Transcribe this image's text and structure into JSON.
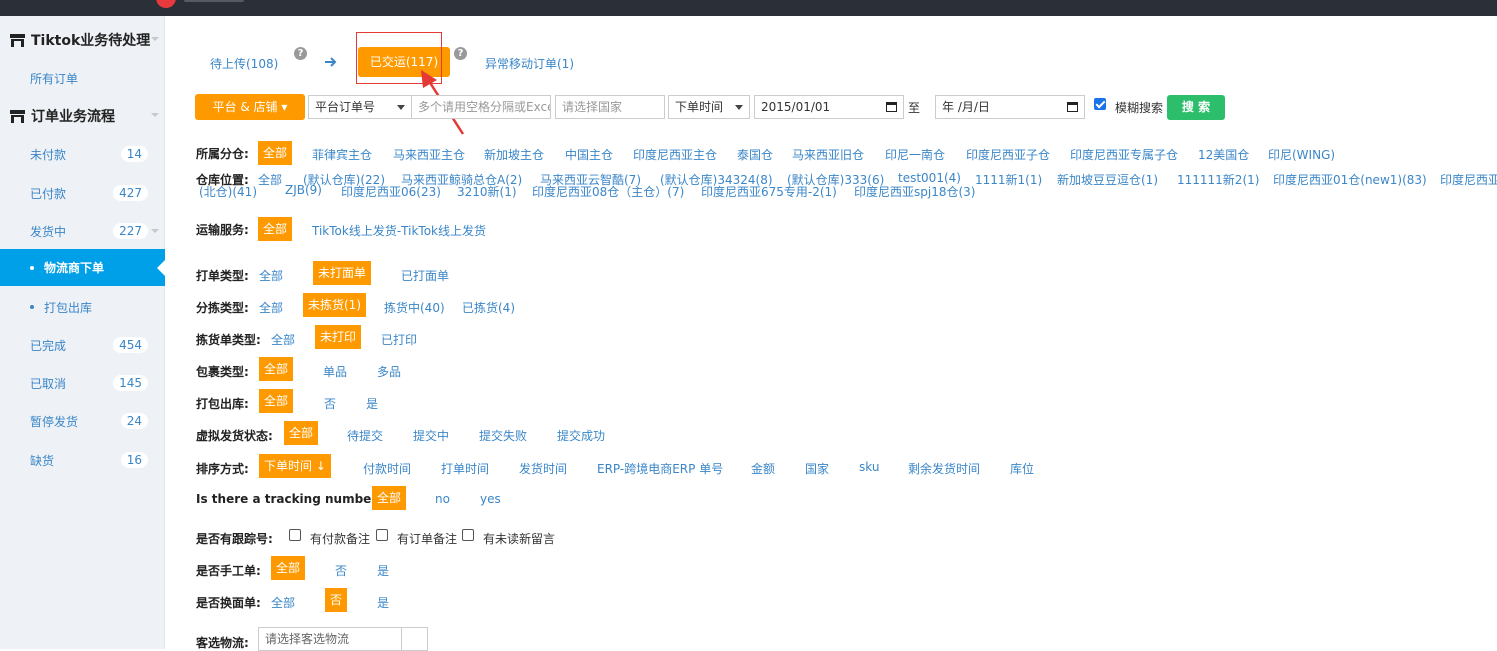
{
  "sidebar": {
    "groups": [
      {
        "label": "Tiktok业务待处理"
      },
      {
        "label": "订单业务流程"
      }
    ],
    "items": [
      {
        "label": "所有订单"
      },
      {
        "label": "未付款",
        "count": "14"
      },
      {
        "label": "已付款",
        "count": "427"
      },
      {
        "label": "发货中",
        "count": "227"
      },
      {
        "label": "物流商下单"
      },
      {
        "label": "打包出库"
      },
      {
        "label": "已完成",
        "count": "454"
      },
      {
        "label": "已取消",
        "count": "145"
      },
      {
        "label": "暂停发货",
        "count": "24"
      },
      {
        "label": "缺货",
        "count": "16"
      }
    ]
  },
  "tabs": {
    "pending_upload": "待上传(108)",
    "shipped": "已交运(117)",
    "abnormal_moved": "异常移动订单(1)"
  },
  "search": {
    "platform_store_btn": "平台 & 店铺",
    "order_no_type": "平台订单号",
    "order_no_placeholder": "多个请用空格分隔或Excel",
    "country_placeholder": "请选择国家",
    "time_type": "下单时间",
    "date_from": "2015/01/01",
    "date_to_label": "至",
    "date_to_placeholder": "年 /月/日",
    "fuzzy_label": "模糊搜索",
    "search_btn": "搜 索"
  },
  "filters": {
    "branch": {
      "label": "所属分仓:",
      "options": [
        "全部",
        "菲律宾主仓",
        "马来西亚主仓",
        "新加坡主仓",
        "中国主仓",
        "印度尼西亚主仓",
        "泰国仓",
        "马来西亚旧仓",
        "印尼一南仓",
        "印度尼西亚子仓",
        "印度尼西亚专属子仓",
        "12美国仓",
        "印尼(WING)"
      ]
    },
    "warehouse": {
      "label": "仓库位置:",
      "line1": [
        "全部",
        "(默认仓库)(22)",
        "马来西亚鲸骑总仓A(2)",
        "马来西亚云智酷(7)",
        "(默认仓库)34324(8)",
        "(默认仓库)333(6)",
        "test001(4)",
        "1111新1(1)",
        "新加坡豆豆逗仓(1)",
        "111111新2(1)",
        "印度尼西亚01仓(new1)(83)",
        "印度尼西亚"
      ],
      "line2": [
        "(北仓)(41)",
        "ZJB(9)",
        "印度尼西亚06(23)",
        "3210新(1)",
        "印度尼西亚08仓（主仓）(7)",
        "印度尼西亚675专用-2(1)",
        "印度尼西亚spj18仓(3)"
      ]
    },
    "shipping": {
      "label": "运输服务:",
      "options": [
        "全部",
        "TikTok线上发货-TikTok线上发货"
      ]
    },
    "print_type": {
      "label": "打单类型:",
      "options": [
        "全部",
        "未打面单",
        "已打面单"
      ]
    },
    "pick_type": {
      "label": "分拣类型:",
      "options": [
        "全部",
        "未拣货(1)",
        "拣货中(40)",
        "已拣货(4)"
      ]
    },
    "pick_list_type": {
      "label": "拣货单类型:",
      "options": [
        "全部",
        "未打印",
        "已打印"
      ]
    },
    "package_type": {
      "label": "包裹类型:",
      "options": [
        "全部",
        "单品",
        "多品"
      ]
    },
    "pack_out": {
      "label": "打包出库:",
      "options": [
        "全部",
        "否",
        "是"
      ]
    },
    "virtual_ship": {
      "label": "虚拟发货状态:",
      "options": [
        "全部",
        "待提交",
        "提交中",
        "提交失败",
        "提交成功"
      ]
    },
    "sort": {
      "label": "排序方式:",
      "options": [
        "下单时间",
        "付款时间",
        "打单时间",
        "发货时间",
        "ERP-跨境电商ERP 单号",
        "金额",
        "国家",
        "sku",
        "剩余发货时间",
        "库位"
      ]
    },
    "tracking": {
      "label": "Is there a tracking number:",
      "options": [
        "全部",
        "no",
        "yes"
      ]
    },
    "has_tracking": {
      "label": "是否有跟踪号:",
      "checks": [
        "有付款备注",
        "有订单备注",
        "有未读新留言"
      ]
    },
    "manual": {
      "label": "是否手工单:",
      "options": [
        "全部",
        "否",
        "是"
      ]
    },
    "label_changed": {
      "label": "是否换面单:",
      "options": [
        "全部",
        "否",
        "是"
      ]
    },
    "logistics": {
      "label": "客选物流:",
      "placeholder": "请选择客选物流"
    }
  },
  "colors": {
    "accent": "#ff9900",
    "link": "#3a86c8",
    "active_nav": "#00a0e9",
    "search_btn": "#2dbe6c",
    "highlight": "#e53935"
  }
}
